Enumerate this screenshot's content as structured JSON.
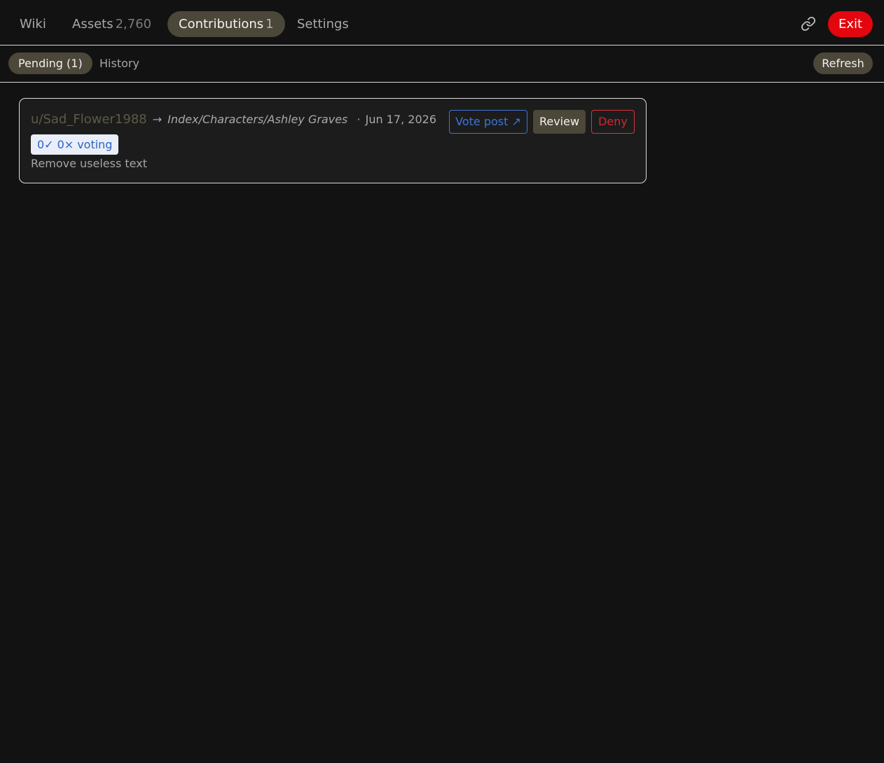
{
  "nav": {
    "tabs": [
      {
        "label": "Wiki",
        "count": ""
      },
      {
        "label": "Assets",
        "count": "2,760"
      },
      {
        "label": "Contributions",
        "count": "1"
      },
      {
        "label": "Settings",
        "count": ""
      }
    ],
    "active_tab": "Contributions",
    "link_icon": "link-icon",
    "exit_label": "Exit"
  },
  "subnav": {
    "pending_label": "Pending (1)",
    "history_label": "History",
    "refresh_label": "Refresh"
  },
  "contributions": [
    {
      "user": "u/Sad_Flower1988",
      "arrow": "→",
      "path": "Index/Characters/Ashley Graves",
      "separator": "·",
      "date": "Jun 17, 2026",
      "yes_votes": "0✓",
      "no_votes": "0×",
      "vote_status": "voting",
      "description": "Remove useless text",
      "vote_post_label": "Vote post ↗",
      "review_label": "Review",
      "deny_label": "Deny"
    }
  ],
  "colors": {
    "background": "#121212",
    "active_pill": "#4b4739",
    "exit": "#e3060e",
    "vote_blue": "#3d74d9",
    "deny_red": "#d7262e"
  }
}
